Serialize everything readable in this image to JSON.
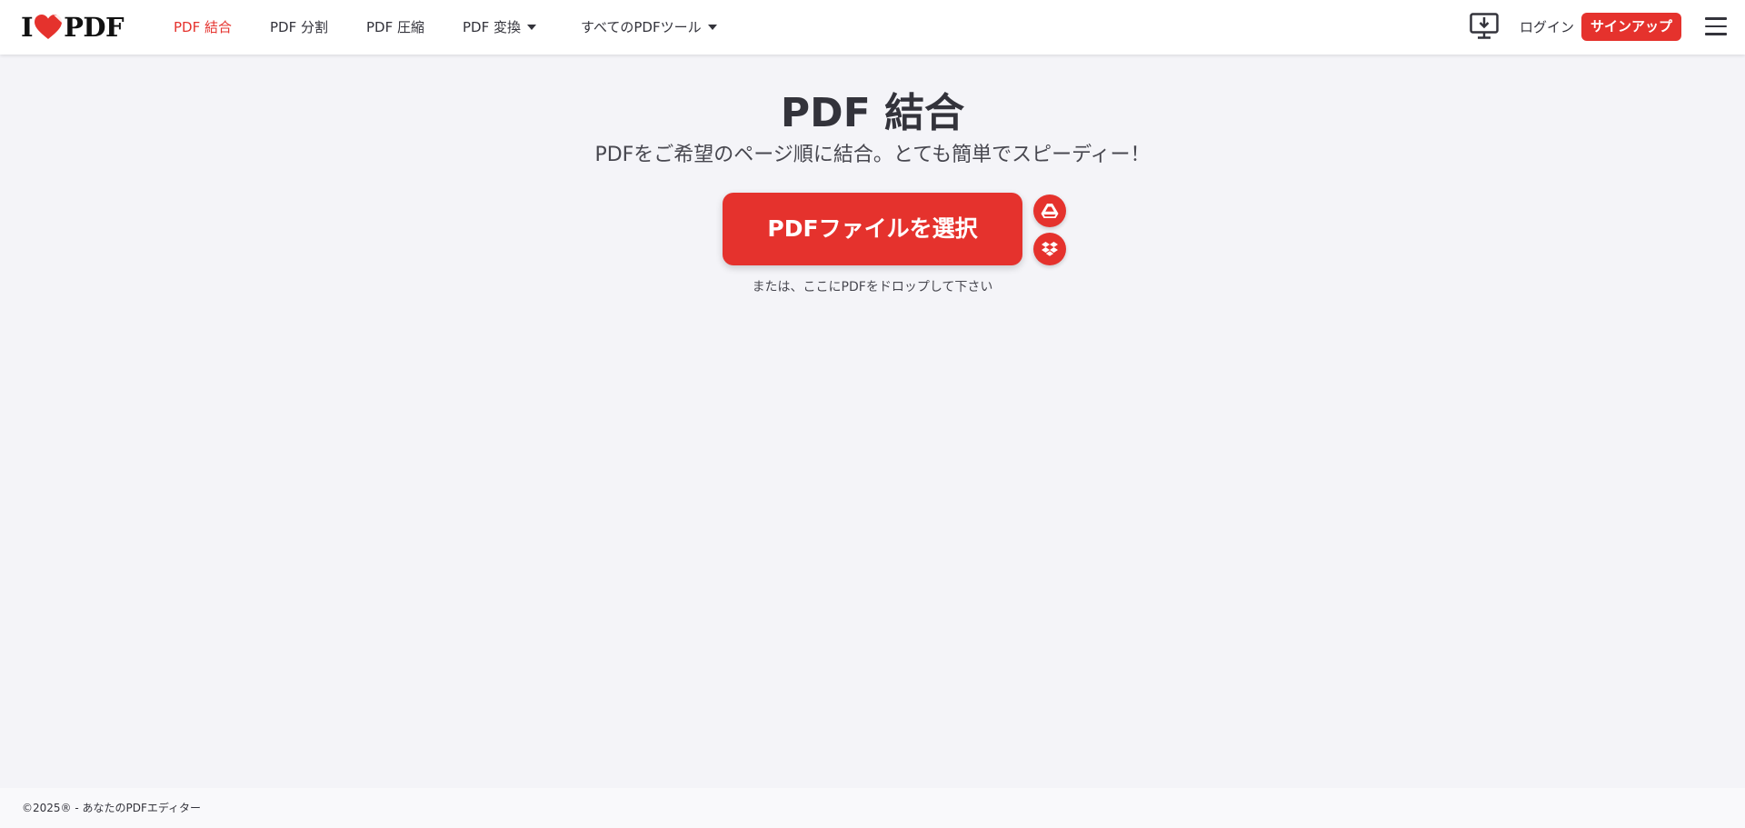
{
  "logo": {
    "text_left": "I",
    "text_right": "PDF"
  },
  "nav": {
    "items": [
      {
        "label": "PDF 結合"
      },
      {
        "label": "PDF 分割"
      },
      {
        "label": "PDF 圧縮"
      },
      {
        "label": "PDF 変換"
      },
      {
        "label": "すべてのPDFツール"
      }
    ]
  },
  "header_right": {
    "desktop_icon": "desktop-download-icon",
    "login_label": "ログイン",
    "signup_label": "サインアップ",
    "menu_icon": "hamburger-menu-icon"
  },
  "main": {
    "title": "PDF 結合",
    "subtitle": "PDFをご希望のページ順に結合。とても簡単でスピーディー！",
    "select_button_label": "PDFファイルを選択",
    "drop_hint": "または、ここにPDFをドロップして下さい",
    "cloud_buttons": [
      {
        "icon": "google-drive-icon"
      },
      {
        "icon": "dropbox-icon"
      }
    ]
  },
  "footer": {
    "copyright": "©2025® - あなたのPDFエディター"
  },
  "colors": {
    "accent": "#e5322d",
    "background": "#f4f4f8",
    "text": "#33333b"
  }
}
